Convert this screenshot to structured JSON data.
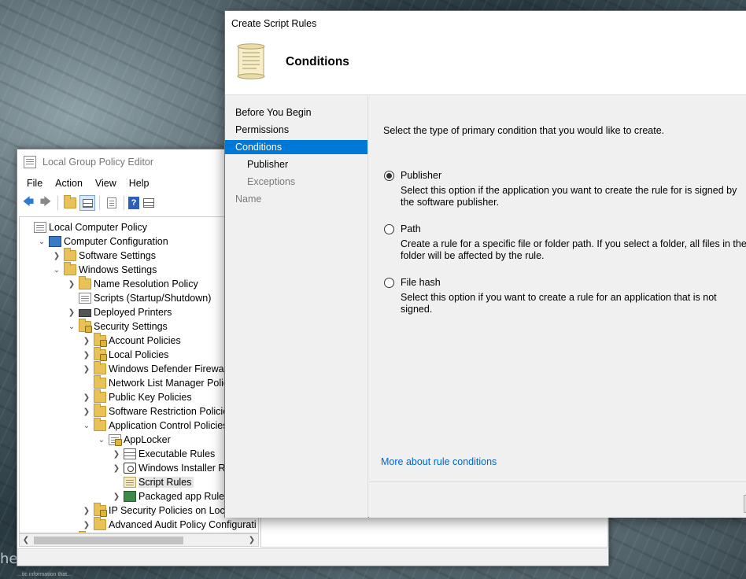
{
  "desktop": {
    "watermark_text": "he",
    "tiny_text": "...tic information that..."
  },
  "gpe": {
    "title": "Local Group Policy Editor",
    "menu": [
      "File",
      "Action",
      "View",
      "Help"
    ],
    "toolbar_icons": [
      "back-icon",
      "forward-icon",
      "up-folder-icon",
      "show-hide-tree-icon",
      "export-list-icon",
      "help-icon",
      "properties-icon"
    ],
    "tree": [
      {
        "label": "Local Computer Policy",
        "depth": 0,
        "expander": "none",
        "icon": "doc"
      },
      {
        "label": "Computer Configuration",
        "depth": 1,
        "expander": "open",
        "icon": "computer"
      },
      {
        "label": "Software Settings",
        "depth": 2,
        "expander": "closed",
        "icon": "folder"
      },
      {
        "label": "Windows Settings",
        "depth": 2,
        "expander": "open",
        "icon": "folder"
      },
      {
        "label": "Name Resolution Policy",
        "depth": 3,
        "expander": "closed",
        "icon": "folder"
      },
      {
        "label": "Scripts (Startup/Shutdown)",
        "depth": 3,
        "expander": "none",
        "icon": "doc"
      },
      {
        "label": "Deployed Printers",
        "depth": 3,
        "expander": "closed",
        "icon": "printer"
      },
      {
        "label": "Security Settings",
        "depth": 3,
        "expander": "open",
        "icon": "folder-lock"
      },
      {
        "label": "Account Policies",
        "depth": 4,
        "expander": "closed",
        "icon": "folder-lock"
      },
      {
        "label": "Local Policies",
        "depth": 4,
        "expander": "closed",
        "icon": "folder-lock"
      },
      {
        "label": "Windows Defender Firewall with",
        "depth": 4,
        "expander": "closed",
        "icon": "folder"
      },
      {
        "label": "Network List Manager Policies",
        "depth": 4,
        "expander": "none",
        "icon": "folder"
      },
      {
        "label": "Public Key Policies",
        "depth": 4,
        "expander": "closed",
        "icon": "folder"
      },
      {
        "label": "Software Restriction Policies",
        "depth": 4,
        "expander": "closed",
        "icon": "folder"
      },
      {
        "label": "Application Control Policies",
        "depth": 4,
        "expander": "open",
        "icon": "folder"
      },
      {
        "label": "AppLocker",
        "depth": 5,
        "expander": "open",
        "icon": "doc-lock"
      },
      {
        "label": "Executable Rules",
        "depth": 6,
        "expander": "closed",
        "icon": "grid"
      },
      {
        "label": "Windows Installer Rules",
        "depth": 6,
        "expander": "closed",
        "icon": "installer"
      },
      {
        "label": "Script Rules",
        "depth": 6,
        "expander": "none",
        "icon": "scroll",
        "selected": true
      },
      {
        "label": "Packaged app Rules",
        "depth": 6,
        "expander": "closed",
        "icon": "package"
      },
      {
        "label": "IP Security Policies on Local Co",
        "depth": 4,
        "expander": "closed",
        "icon": "folder-lock"
      },
      {
        "label": "Advanced Audit Policy Configurati",
        "depth": 4,
        "expander": "closed",
        "icon": "folder"
      },
      {
        "label": "Policy-based QoS",
        "depth": 3,
        "expander": "closed",
        "icon": "folder"
      }
    ]
  },
  "wizard": {
    "title": "Create Script Rules",
    "heading": "Conditions",
    "nav": [
      {
        "label": "Before You Begin",
        "sub": false,
        "state": "normal"
      },
      {
        "label": "Permissions",
        "sub": false,
        "state": "normal"
      },
      {
        "label": "Conditions",
        "sub": false,
        "state": "active"
      },
      {
        "label": "Publisher",
        "sub": true,
        "state": "normal"
      },
      {
        "label": "Exceptions",
        "sub": true,
        "state": "dim"
      },
      {
        "label": "Name",
        "sub": false,
        "state": "dim"
      }
    ],
    "prompt": "Select the type of primary condition that you would like to create.",
    "options": [
      {
        "label": "Publisher",
        "checked": true,
        "description": "Select this option if the application you want to create the rule for is signed by the software publisher."
      },
      {
        "label": "Path",
        "checked": false,
        "description": "Create a rule for a specific file or folder path. If you select a folder, all files in the folder will be affected by the rule."
      },
      {
        "label": "File hash",
        "checked": false,
        "description": "Select this option if you want to create a rule for an application that is not signed."
      }
    ],
    "more_link": "More about rule conditions"
  }
}
